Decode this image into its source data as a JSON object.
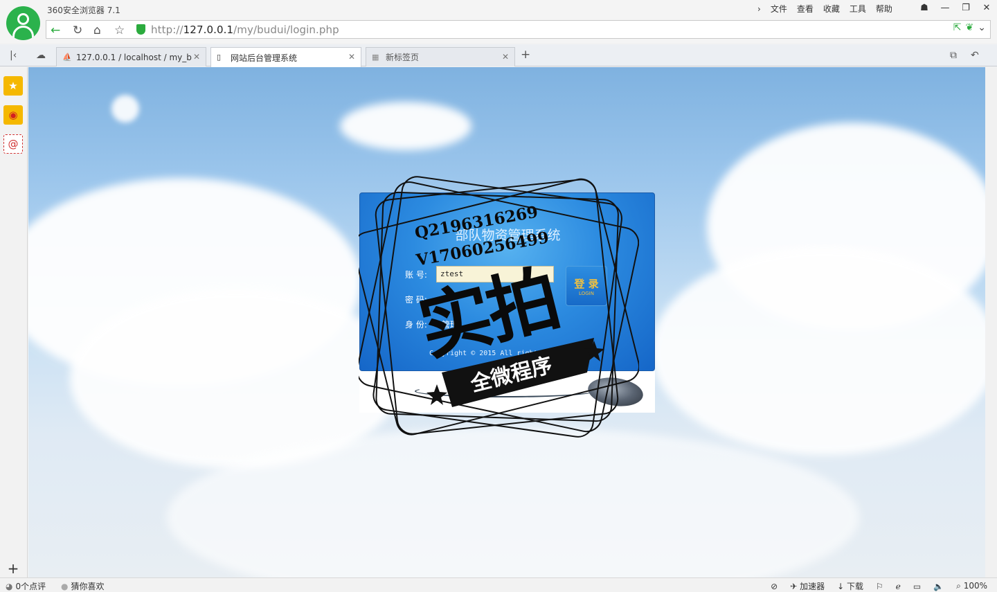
{
  "window": {
    "app_title": "360安全浏览器 7.1",
    "menu": [
      "文件",
      "查看",
      "收藏",
      "工具",
      "帮助"
    ],
    "controls": {
      "restore": "🗗",
      "minimize": "—",
      "maximize": "❐",
      "close": "✕"
    }
  },
  "address_bar": {
    "url_prefix": "http://",
    "url_host": "127.0.0.1",
    "url_path": "/my/budui/login.php"
  },
  "tabs": [
    {
      "label": "127.0.0.1 / localhost / my_b",
      "icon": "pma-icon",
      "active": false
    },
    {
      "label": "网站后台管理系统",
      "icon": "page-icon",
      "active": true
    },
    {
      "label": "新标签页",
      "icon": "grid-icon",
      "active": false
    }
  ],
  "login": {
    "title": "部队物资管理系统",
    "account_label": "账  号:",
    "account_value": "ztest",
    "password_label": "密  码:",
    "role_label": "身  份:",
    "role_value": "管理",
    "login_button": "登 录",
    "login_button_sub": "LOGIN",
    "copyright": "Copyright © 2015 All rights"
  },
  "watermark": {
    "line1": "Q2196316269",
    "line2": "V17060256499",
    "big": "实拍",
    "banner": "全微程序"
  },
  "status_bar": {
    "reviews": "0个点评",
    "guess": "猜你喜欢",
    "accelerator": "加速器",
    "download": "下载",
    "zoom": "100%"
  },
  "colors": {
    "accent_green": "#2bb24c",
    "panel_blue": "#2c8be0"
  }
}
